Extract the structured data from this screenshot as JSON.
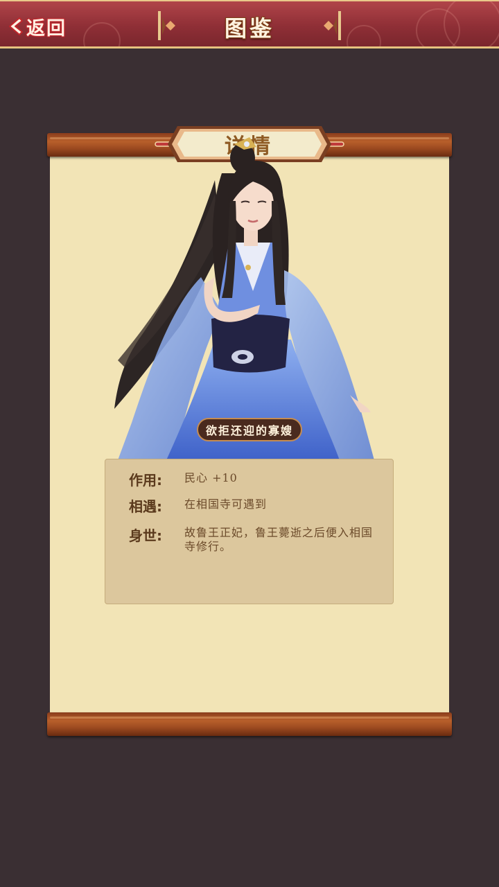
{
  "header": {
    "back_label": "返回",
    "title": "图鉴"
  },
  "scroll": {
    "title": "详情"
  },
  "character": {
    "name": "欲拒还迎的寡嫂",
    "info": [
      {
        "label": "作用:",
        "value": "民心 +10"
      },
      {
        "label": "相遇:",
        "value": "在相国寺可遇到"
      },
      {
        "label": "身世:",
        "value": "故鲁王正妃，鲁王薨逝之后便入相国寺修行。"
      }
    ]
  },
  "colors": {
    "background": "#3a2f33",
    "header_red": "#8f2f36",
    "paper": "#f2e4b6",
    "wood": "#9c4a20",
    "info_panel": "#dcc79d"
  }
}
